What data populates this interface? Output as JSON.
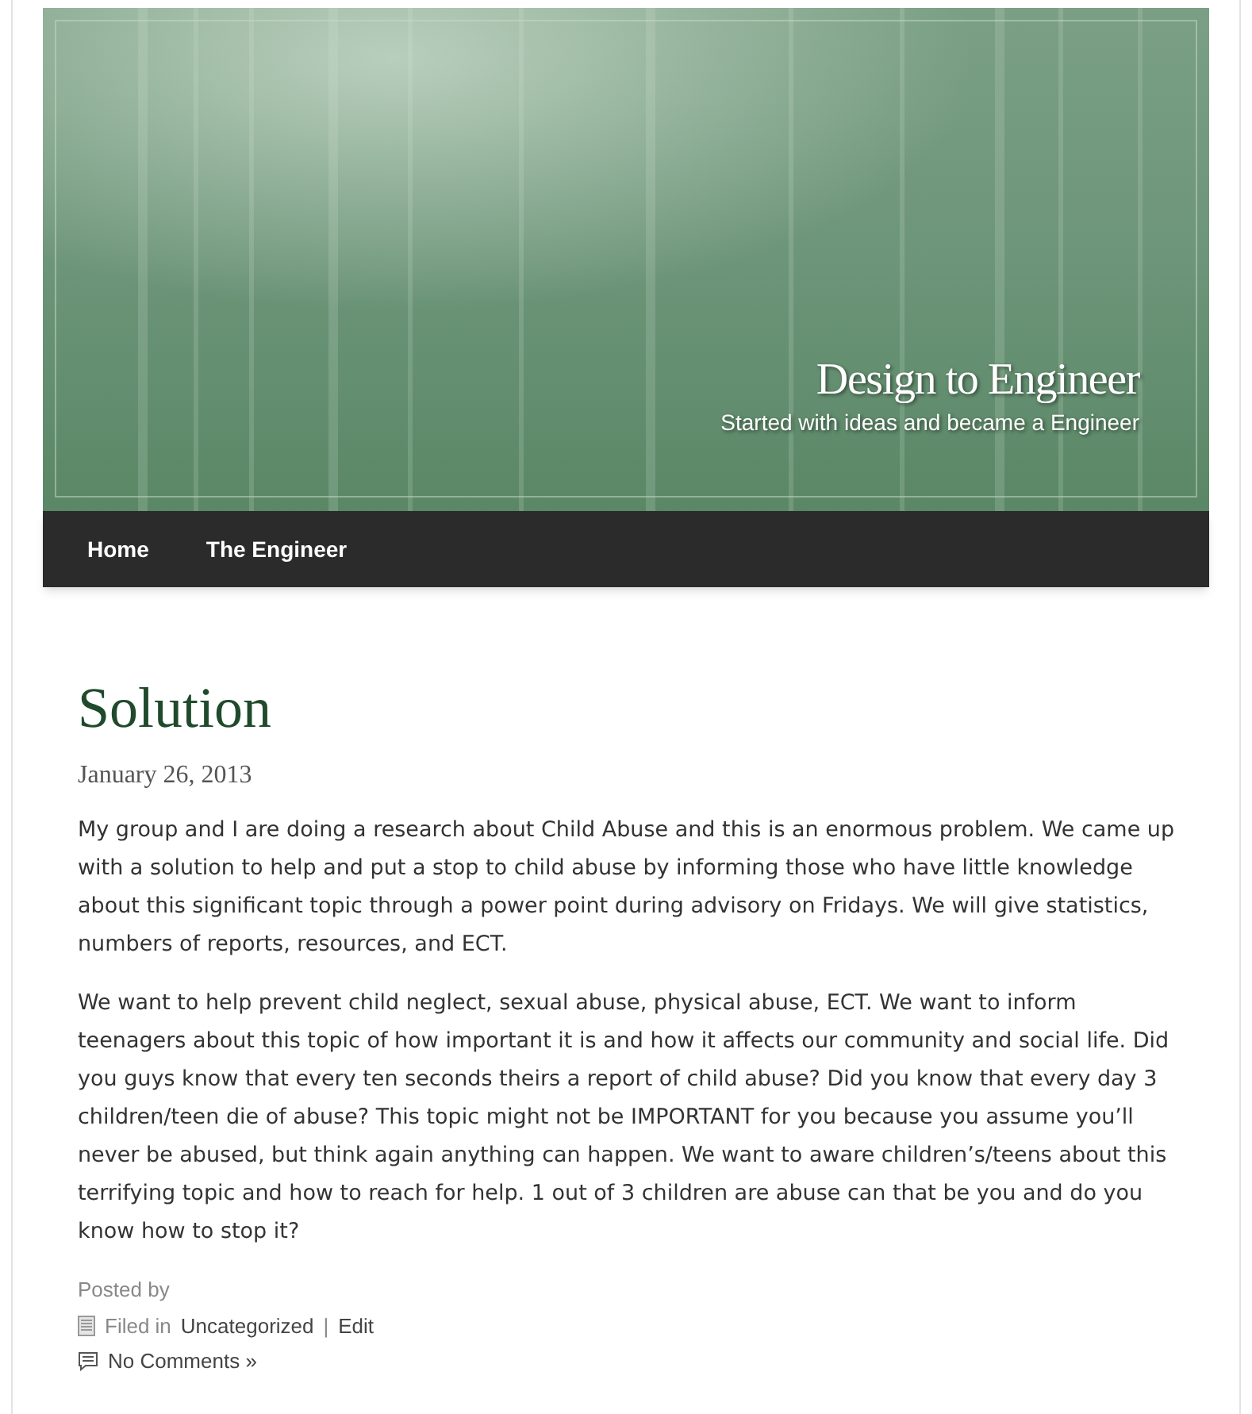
{
  "header": {
    "title": "Design to Engineer",
    "tagline": "Started with ideas and became a Engineer"
  },
  "nav": [
    {
      "label": "Home"
    },
    {
      "label": "The Engineer"
    }
  ],
  "post": {
    "title": "Solution",
    "date": "January 26, 2013",
    "paragraphs": [
      "My group and I are doing a research about Child Abuse and this is an enormous problem. We came up with a solution to help and put a stop to child abuse by informing those who have little knowledge about this significant topic through a power point during advisory on Fridays. We will give statistics, numbers of reports, resources, and ECT.",
      "We want to help prevent child neglect, sexual abuse, physical abuse, ECT. We want to inform teenagers about this topic of how important it is and how it affects our community and social life. Did you guys know that every ten seconds theirs a report of child abuse? Did you know that every day 3 children/teen die of abuse? This topic might not be IMPORTANT for you because you assume you’ll never be abused, but think again anything can happen. We want to aware children’s/teens about this terrifying topic and how to reach for help. 1 out of 3 children are abuse can  that be you and do you know how to stop it?"
    ],
    "posted_by": "Posted by",
    "filed_label": "Filed in",
    "category": "Uncategorized",
    "separator": "|",
    "edit": "Edit",
    "comments": "No Comments »"
  }
}
